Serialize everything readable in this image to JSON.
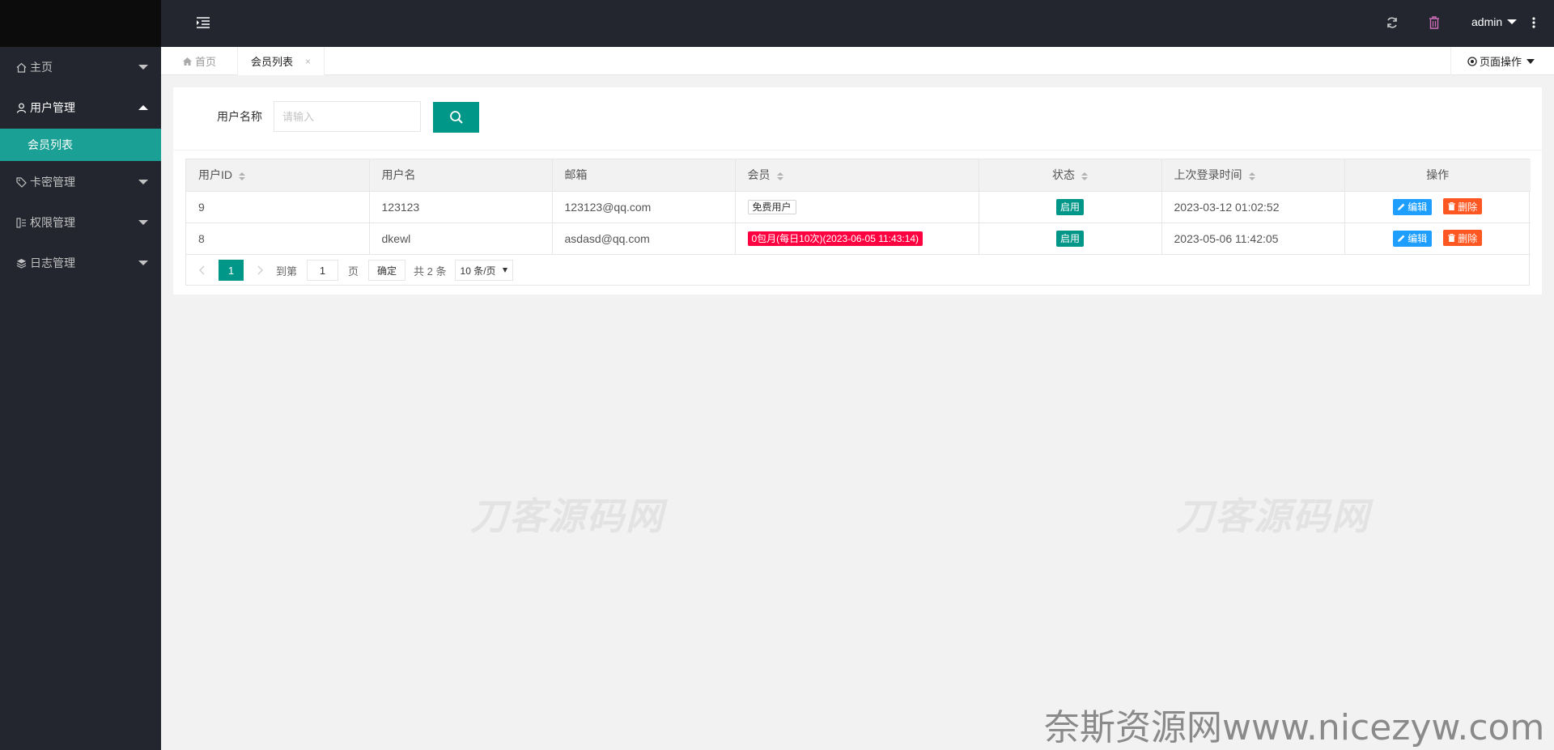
{
  "sidebar": {
    "items": [
      {
        "label": "主页",
        "icon": "home-icon"
      },
      {
        "label": "用户管理",
        "icon": "user-icon"
      },
      {
        "label": "卡密管理",
        "icon": "tag-icon"
      },
      {
        "label": "权限管理",
        "icon": "permission-icon"
      },
      {
        "label": "日志管理",
        "icon": "layers-icon"
      }
    ],
    "sub_item": "会员列表"
  },
  "header": {
    "user": "admin"
  },
  "tabs": {
    "home": "首页",
    "active": "会员列表",
    "close": "×",
    "page_ops": "页面操作"
  },
  "search": {
    "label": "用户名称",
    "placeholder": "请输入"
  },
  "table": {
    "columns": [
      "用户ID",
      "用户名",
      "邮箱",
      "会员",
      "状态",
      "上次登录时间",
      "操作"
    ],
    "rows": [
      {
        "id": "9",
        "username": "123123",
        "email": "123123@qq.com",
        "member": "免费用户",
        "member_type": "free",
        "status": "启用",
        "last_login": "2023-03-12 01:02:52"
      },
      {
        "id": "8",
        "username": "dkewl",
        "email": "asdasd@qq.com",
        "member": "0包月(每日10次)(2023-06-05 11:43:14)",
        "member_type": "paid",
        "status": "启用",
        "last_login": "2023-05-06 11:42:05"
      }
    ],
    "edit_label": "编辑",
    "delete_label": "删除"
  },
  "pager": {
    "current": "1",
    "goto_label": "到第",
    "goto_value": "1",
    "page_unit": "页",
    "confirm": "确定",
    "total": "共 2 条",
    "page_size": "10 条/页"
  },
  "watermarks": {
    "mark1": "刀客源码网",
    "mark2": "刀客源码网",
    "footer": "奈斯资源网www.nicezyw.com"
  },
  "colors": {
    "sidebar_bg": "#23262e",
    "accent": "#009688",
    "active_menu": "#1aa094",
    "edit_btn": "#1e9fff",
    "delete_btn": "#ff5722",
    "vip_badge": "#ff0040"
  }
}
